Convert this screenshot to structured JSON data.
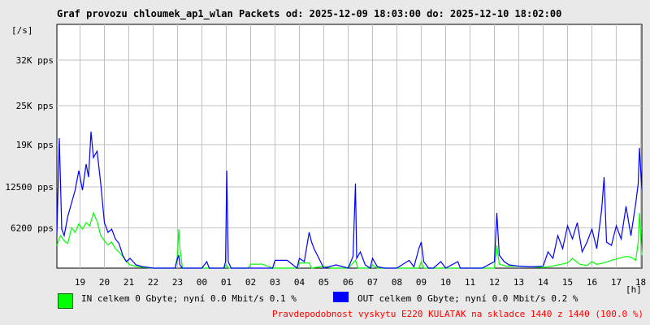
{
  "chart_data": {
    "type": "line",
    "title": "Graf provozu chloumek_ap1_wlan Packets od: 2025-12-09 18:03:00 do: 2025-12-10 18:02:00",
    "ylabel": "[/s]",
    "xlabel": "[h]",
    "ylim": [
      0,
      37500
    ],
    "xlim": [
      18.05,
      42.05
    ],
    "grid": true,
    "y_ticks": [
      {
        "value": 6200,
        "label": "6200 pps"
      },
      {
        "value": 12500,
        "label": "12500 pps"
      },
      {
        "value": 19000,
        "label": "19K pps"
      },
      {
        "value": 25000,
        "label": "25K pps"
      },
      {
        "value": 32000,
        "label": "32K pps"
      }
    ],
    "x_ticks": [
      {
        "value": 19,
        "label": "19"
      },
      {
        "value": 20,
        "label": "20"
      },
      {
        "value": 21,
        "label": "21"
      },
      {
        "value": 22,
        "label": "22"
      },
      {
        "value": 23,
        "label": "23"
      },
      {
        "value": 24,
        "label": "00"
      },
      {
        "value": 25,
        "label": "01"
      },
      {
        "value": 26,
        "label": "02"
      },
      {
        "value": 27,
        "label": "03"
      },
      {
        "value": 28,
        "label": "04"
      },
      {
        "value": 29,
        "label": "05"
      },
      {
        "value": 30,
        "label": "06"
      },
      {
        "value": 31,
        "label": "07"
      },
      {
        "value": 32,
        "label": "08"
      },
      {
        "value": 33,
        "label": "09"
      },
      {
        "value": 34,
        "label": "10"
      },
      {
        "value": 35,
        "label": "11"
      },
      {
        "value": 36,
        "label": "12"
      },
      {
        "value": 37,
        "label": "13"
      },
      {
        "value": 38,
        "label": "14"
      },
      {
        "value": 39,
        "label": "15"
      },
      {
        "value": 40,
        "label": "16"
      },
      {
        "value": 41,
        "label": "17"
      },
      {
        "value": 42,
        "label": "18"
      }
    ],
    "series": [
      {
        "name": "IN",
        "color": "#00ff00",
        "points": [
          [
            18.05,
            3500
          ],
          [
            18.2,
            5000
          ],
          [
            18.35,
            4200
          ],
          [
            18.5,
            3800
          ],
          [
            18.65,
            6200
          ],
          [
            18.8,
            5500
          ],
          [
            18.95,
            6800
          ],
          [
            19.1,
            6000
          ],
          [
            19.25,
            7000
          ],
          [
            19.4,
            6500
          ],
          [
            19.55,
            8500
          ],
          [
            19.7,
            7200
          ],
          [
            19.85,
            5000
          ],
          [
            20.0,
            4200
          ],
          [
            20.15,
            3600
          ],
          [
            20.3,
            4000
          ],
          [
            20.45,
            3000
          ],
          [
            20.6,
            2500
          ],
          [
            20.75,
            1800
          ],
          [
            20.9,
            1000
          ],
          [
            21.05,
            500
          ],
          [
            21.3,
            300
          ],
          [
            21.6,
            100
          ],
          [
            22.0,
            0
          ],
          [
            22.5,
            0
          ],
          [
            22.9,
            0
          ],
          [
            23.0,
            2000
          ],
          [
            23.05,
            6000
          ],
          [
            23.1,
            3000
          ],
          [
            23.2,
            0
          ],
          [
            24.0,
            0
          ],
          [
            24.9,
            0
          ],
          [
            25.0,
            500
          ],
          [
            25.1,
            0
          ],
          [
            25.9,
            0
          ],
          [
            26.0,
            600
          ],
          [
            26.5,
            600
          ],
          [
            26.9,
            0
          ],
          [
            27.5,
            0
          ],
          [
            27.9,
            0
          ],
          [
            28.0,
            800
          ],
          [
            28.4,
            800
          ],
          [
            28.5,
            0
          ],
          [
            29.0,
            300
          ],
          [
            29.3,
            0
          ],
          [
            30.0,
            0
          ],
          [
            30.3,
            1200
          ],
          [
            30.4,
            0
          ],
          [
            30.9,
            0
          ],
          [
            31.0,
            500
          ],
          [
            31.2,
            0
          ],
          [
            32.0,
            0
          ],
          [
            32.9,
            0
          ],
          [
            33.0,
            1000
          ],
          [
            33.1,
            0
          ],
          [
            33.5,
            0
          ],
          [
            34.0,
            0
          ],
          [
            35.0,
            0
          ],
          [
            36.0,
            0
          ],
          [
            36.1,
            3500
          ],
          [
            36.2,
            600
          ],
          [
            36.5,
            300
          ],
          [
            37.0,
            300
          ],
          [
            37.5,
            200
          ],
          [
            38.0,
            100
          ],
          [
            38.5,
            400
          ],
          [
            39.0,
            800
          ],
          [
            39.2,
            1500
          ],
          [
            39.5,
            600
          ],
          [
            39.8,
            400
          ],
          [
            40.0,
            1000
          ],
          [
            40.2,
            600
          ],
          [
            40.5,
            800
          ],
          [
            40.8,
            1200
          ],
          [
            41.0,
            1400
          ],
          [
            41.2,
            1600
          ],
          [
            41.4,
            1800
          ],
          [
            41.6,
            1700
          ],
          [
            41.8,
            1200
          ],
          [
            41.9,
            4000
          ],
          [
            41.95,
            8500
          ],
          [
            42.05,
            2000
          ]
        ]
      },
      {
        "name": "OUT",
        "color": "#0000ff",
        "points": [
          [
            18.05,
            5000
          ],
          [
            18.15,
            20000
          ],
          [
            18.25,
            6000
          ],
          [
            18.35,
            5000
          ],
          [
            18.5,
            8000
          ],
          [
            18.65,
            10000
          ],
          [
            18.8,
            12000
          ],
          [
            18.95,
            15000
          ],
          [
            19.1,
            12000
          ],
          [
            19.25,
            16000
          ],
          [
            19.35,
            14000
          ],
          [
            19.45,
            21000
          ],
          [
            19.55,
            17000
          ],
          [
            19.7,
            18000
          ],
          [
            19.85,
            13000
          ],
          [
            20.0,
            7000
          ],
          [
            20.15,
            5500
          ],
          [
            20.3,
            6000
          ],
          [
            20.45,
            4500
          ],
          [
            20.6,
            3800
          ],
          [
            20.75,
            2000
          ],
          [
            20.9,
            1000
          ],
          [
            21.05,
            1500
          ],
          [
            21.3,
            500
          ],
          [
            21.6,
            200
          ],
          [
            22.0,
            0
          ],
          [
            22.5,
            0
          ],
          [
            22.9,
            0
          ],
          [
            23.0,
            1500
          ],
          [
            23.05,
            2000
          ],
          [
            23.1,
            500
          ],
          [
            23.2,
            0
          ],
          [
            24.0,
            0
          ],
          [
            24.2,
            1000
          ],
          [
            24.3,
            0
          ],
          [
            24.9,
            0
          ],
          [
            24.97,
            1000
          ],
          [
            25.02,
            15000
          ],
          [
            25.08,
            1000
          ],
          [
            25.2,
            0
          ],
          [
            26.0,
            0
          ],
          [
            26.9,
            0
          ],
          [
            27.0,
            1200
          ],
          [
            27.5,
            1200
          ],
          [
            27.9,
            0
          ],
          [
            28.0,
            1500
          ],
          [
            28.2,
            1000
          ],
          [
            28.4,
            5500
          ],
          [
            28.5,
            4000
          ],
          [
            28.6,
            3000
          ],
          [
            28.8,
            1500
          ],
          [
            29.0,
            0
          ],
          [
            29.5,
            500
          ],
          [
            30.0,
            0
          ],
          [
            30.2,
            1800
          ],
          [
            30.3,
            13000
          ],
          [
            30.35,
            1500
          ],
          [
            30.5,
            2500
          ],
          [
            30.7,
            500
          ],
          [
            30.9,
            0
          ],
          [
            31.0,
            1500
          ],
          [
            31.2,
            200
          ],
          [
            31.5,
            0
          ],
          [
            32.0,
            0
          ],
          [
            32.5,
            1200
          ],
          [
            32.7,
            200
          ],
          [
            32.9,
            3000
          ],
          [
            33.0,
            4000
          ],
          [
            33.1,
            1000
          ],
          [
            33.3,
            0
          ],
          [
            33.5,
            0
          ],
          [
            33.8,
            1000
          ],
          [
            34.0,
            0
          ],
          [
            34.5,
            1000
          ],
          [
            34.6,
            0
          ],
          [
            35.0,
            0
          ],
          [
            35.5,
            0
          ],
          [
            36.0,
            1000
          ],
          [
            36.1,
            8500
          ],
          [
            36.2,
            2000
          ],
          [
            36.4,
            1000
          ],
          [
            36.6,
            500
          ],
          [
            37.0,
            300
          ],
          [
            37.5,
            200
          ],
          [
            38.0,
            300
          ],
          [
            38.2,
            2500
          ],
          [
            38.4,
            1500
          ],
          [
            38.6,
            5000
          ],
          [
            38.8,
            3000
          ],
          [
            39.0,
            6500
          ],
          [
            39.2,
            4500
          ],
          [
            39.4,
            7000
          ],
          [
            39.6,
            2500
          ],
          [
            39.8,
            4000
          ],
          [
            40.0,
            6000
          ],
          [
            40.2,
            3000
          ],
          [
            40.4,
            9000
          ],
          [
            40.5,
            14000
          ],
          [
            40.6,
            4000
          ],
          [
            40.8,
            3500
          ],
          [
            41.0,
            6500
          ],
          [
            41.2,
            4500
          ],
          [
            41.4,
            9500
          ],
          [
            41.6,
            5000
          ],
          [
            41.8,
            10000
          ],
          [
            41.9,
            13000
          ],
          [
            41.95,
            18500
          ],
          [
            42.05,
            12000
          ]
        ]
      }
    ]
  },
  "legend": {
    "in_text": "IN celkem 0 Gbyte; nyní   0.0 Mbit/s 0.1 %",
    "out_text": "OUT celkem 0 Gbyte; nyní   0.0 Mbit/s 0.2 %",
    "in_color": "#00ff00",
    "out_color": "#0000ff"
  },
  "note": "Pravdepodobnost vyskytu E220 KULATAK na skladce 1440 z 1440 (100.0 %)"
}
